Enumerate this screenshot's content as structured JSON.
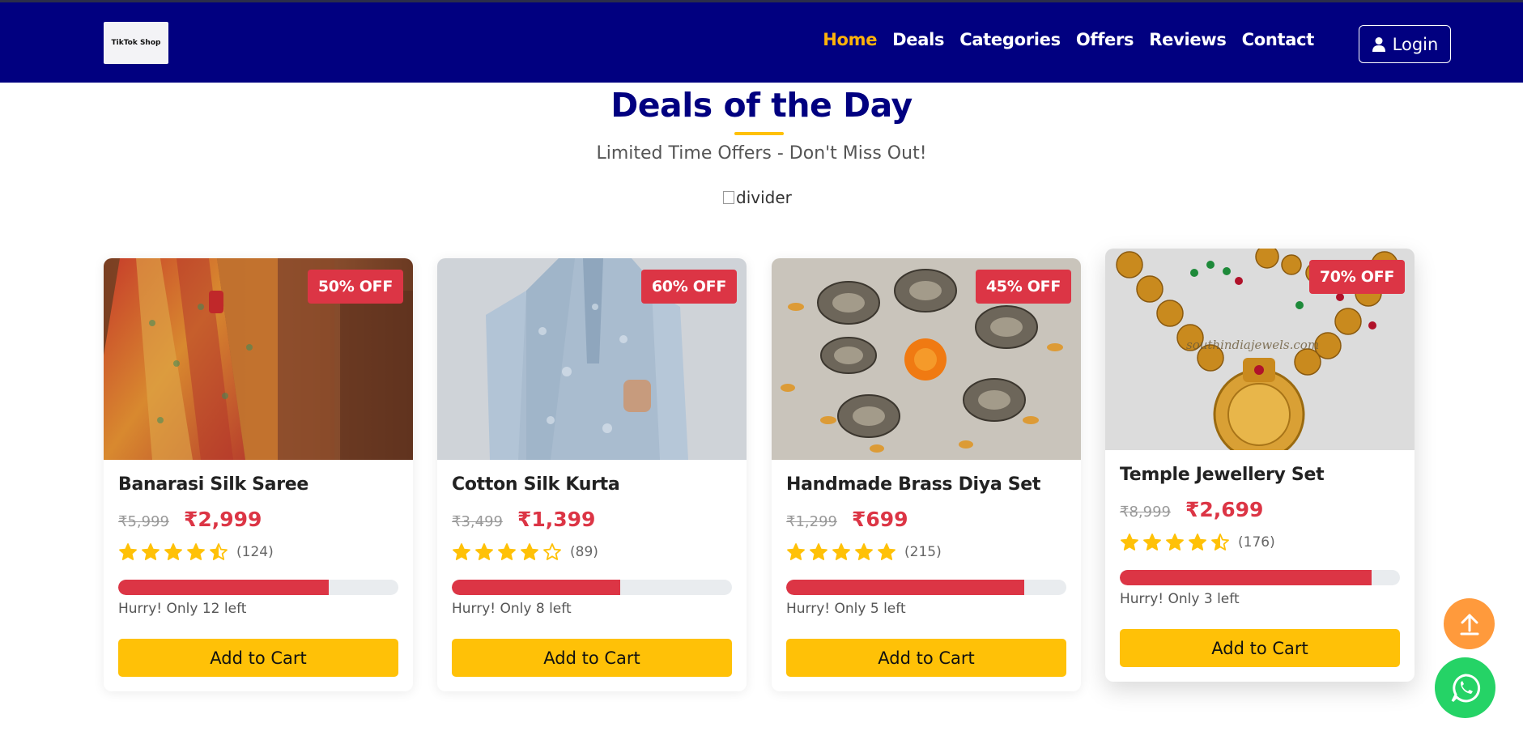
{
  "header": {
    "logo_text": "TikTok Shop",
    "nav": [
      {
        "label": "Home",
        "active": true
      },
      {
        "label": "Deals"
      },
      {
        "label": "Categories"
      },
      {
        "label": "Offers"
      },
      {
        "label": "Reviews"
      },
      {
        "label": "Contact"
      }
    ],
    "login_label": "Login",
    "colors": {
      "bar": "#010080",
      "active": "#ffb20a"
    }
  },
  "section": {
    "title": "Deals of the Day",
    "subtitle": "Limited Time Offers - Don't Miss Out!",
    "divider_alt": "divider"
  },
  "products": [
    {
      "name": "Banarasi Silk Saree",
      "badge": "50% OFF",
      "old_price": "₹5,999",
      "new_price": "₹2,999",
      "rating": 4.5,
      "reviews": "(124)",
      "stock_fraction": 0.75,
      "stock_text": "Hurry! Only 12 left",
      "cart_label": "Add to Cart",
      "image": "saree-photo"
    },
    {
      "name": "Cotton Silk Kurta",
      "badge": "60% OFF",
      "old_price": "₹3,499",
      "new_price": "₹1,399",
      "rating": 4,
      "reviews": "(89)",
      "stock_fraction": 0.6,
      "stock_text": "Hurry! Only 8 left",
      "cart_label": "Add to Cart",
      "image": "kurta-photo"
    },
    {
      "name": "Handmade Brass Diya Set",
      "badge": "45% OFF",
      "old_price": "₹1,299",
      "new_price": "₹699",
      "rating": 5,
      "reviews": "(215)",
      "stock_fraction": 0.85,
      "stock_text": "Hurry! Only 5 left",
      "cart_label": "Add to Cart",
      "image": "diya-photo"
    },
    {
      "name": "Temple Jewellery Set",
      "badge": "70% OFF",
      "old_price": "₹8,999",
      "new_price": "₹2,699",
      "rating": 4.5,
      "reviews": "(176)",
      "stock_fraction": 0.9,
      "stock_text": "Hurry! Only 3 left",
      "cart_label": "Add to Cart",
      "image": "jewellery-photo",
      "image_watermark": "southindiajewels.com"
    }
  ],
  "floating": {
    "scroll_top_icon": "arrow-up-icon",
    "whatsapp_icon": "whatsapp-icon"
  }
}
